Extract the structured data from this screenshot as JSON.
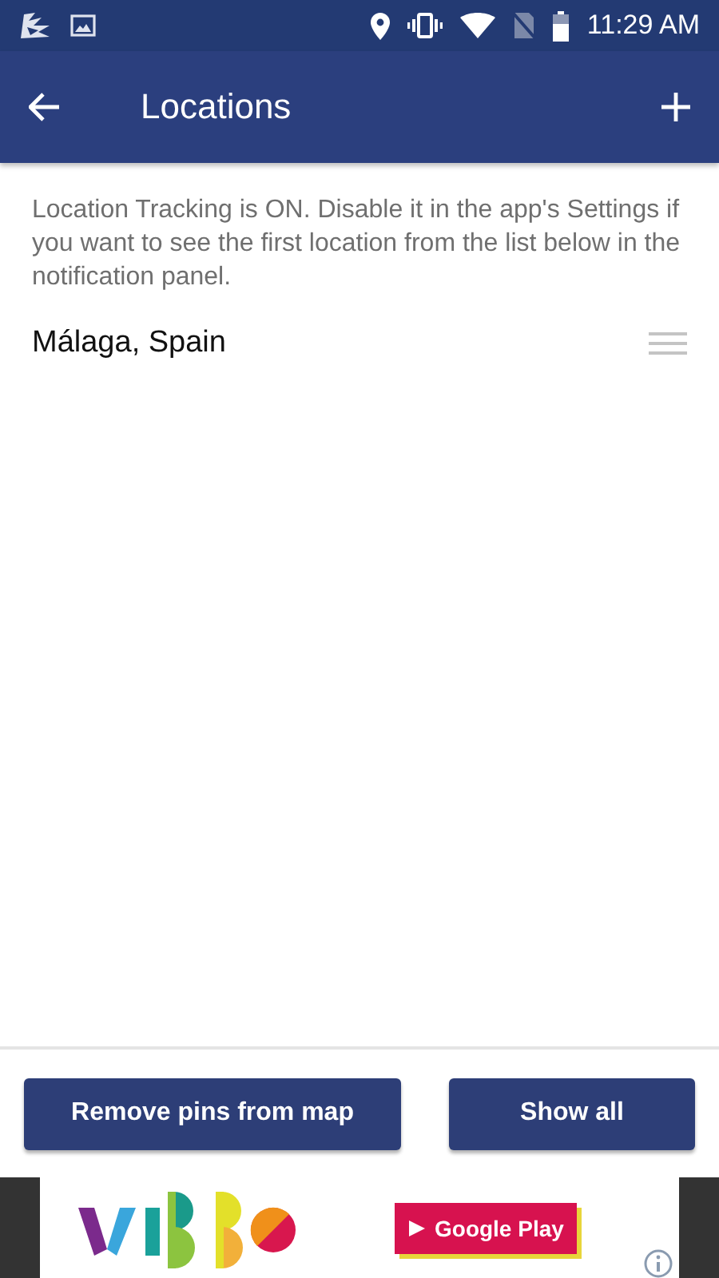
{
  "status_bar": {
    "time": "11:29 AM"
  },
  "app_bar": {
    "title": "Locations"
  },
  "notice": "Location Tracking is ON. Disable it in the app's Settings if you want to see the first location from the list below in the notification panel.",
  "locations": [
    {
      "name": "Málaga, Spain"
    }
  ],
  "buttons": [
    {
      "label": "Remove pins from map"
    },
    {
      "label": "Show all"
    }
  ],
  "ad": {
    "store_button": "Google Play"
  }
}
